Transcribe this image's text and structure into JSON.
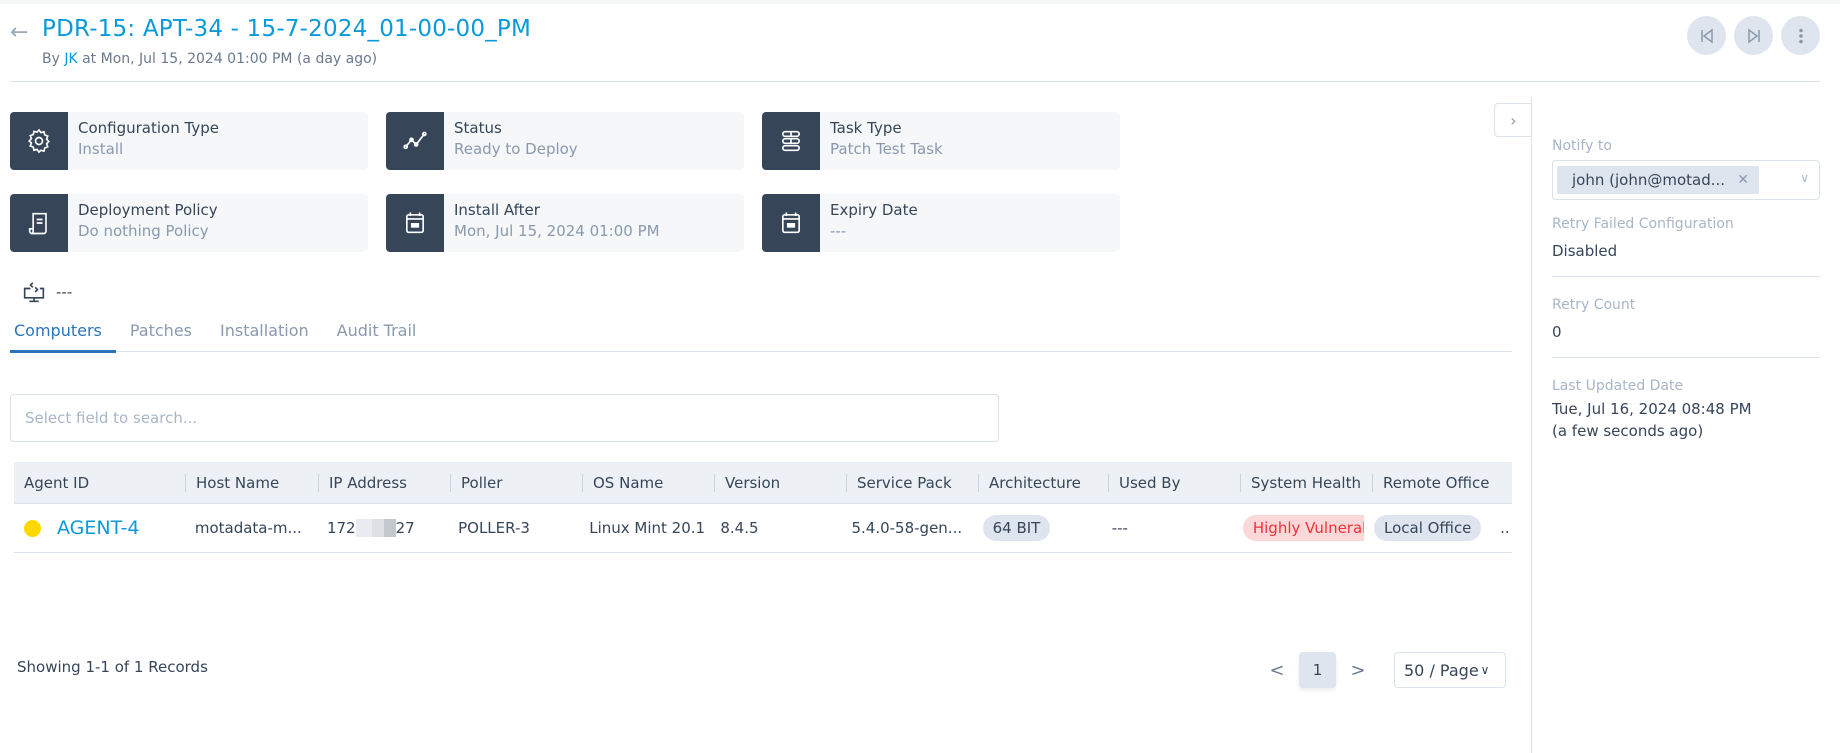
{
  "header": {
    "title": "PDR-15: APT-34 - 15-7-2024_01-00-00_PM",
    "by_prefix": "By ",
    "author": "JK",
    "by_suffix": " at Mon, Jul 15, 2024 01:00 PM (a day ago)"
  },
  "cards": [
    {
      "label": "Configuration Type",
      "value": "Install",
      "icon": "gear-icon"
    },
    {
      "label": "Status",
      "value": "Ready to Deploy",
      "icon": "chart-line-icon"
    },
    {
      "label": "Task Type",
      "value": "Patch Test Task",
      "icon": "task-list-icon"
    },
    {
      "label": "Deployment Policy",
      "value": "Do nothing Policy",
      "icon": "scroll-icon"
    },
    {
      "label": "Install After",
      "value": "Mon, Jul 15, 2024 01:00 PM",
      "icon": "calendar-icon"
    },
    {
      "label": "Expiry Date",
      "value": "---",
      "icon": "calendar-icon"
    }
  ],
  "agent_line": {
    "value": "---",
    "icon": "remote-desktop-icon"
  },
  "tabs": [
    {
      "label": "Computers",
      "active": true
    },
    {
      "label": "Patches"
    },
    {
      "label": "Installation"
    },
    {
      "label": "Audit Trail"
    }
  ],
  "search": {
    "placeholder": "Select field to search...",
    "value": ""
  },
  "table": {
    "columns": [
      "Agent ID",
      "Host Name",
      "IP Address",
      "Poller",
      "OS Name",
      "Version",
      "Service Pack",
      "Architecture",
      "Used By",
      "System Health",
      "Remote Office"
    ],
    "rows": [
      {
        "status_color": "#ffd800",
        "agent_id": "AGENT-4",
        "host_name": "motadata-m...",
        "ip_prefix": "172",
        "ip_suffix": "27",
        "poller": "POLLER-3",
        "os_name": "Linux Mint 20.1",
        "version": "8.4.5",
        "service_pack": "5.4.0-58-gen...",
        "architecture": "64 BIT",
        "used_by": "---",
        "system_health": "Highly Vulnerable",
        "remote_office": "Local Office",
        "overflow": ".."
      }
    ]
  },
  "footer": {
    "records": "Showing 1-1 of 1 Records"
  },
  "pagination": {
    "prev": "<",
    "current": "1",
    "next": ">",
    "page_size": "50 / Page"
  },
  "side": {
    "notify_label": "Notify to",
    "notify_tag": "john (john@motad...",
    "retry_failed_label": "Retry Failed Configuration",
    "retry_failed_value": "Disabled",
    "retry_count_label": "Retry Count",
    "retry_count_value": "0",
    "last_updated_label": "Last Updated Date",
    "last_updated_value": "Tue, Jul 16, 2024 08:48 PM",
    "last_updated_relative": "(a few seconds ago)"
  },
  "colors": {
    "accent": "#0a9ad8",
    "tab_active": "#2b74b9",
    "icon_bg": "#364658",
    "danger": "#f0303a",
    "agent_status": "#ffd800"
  }
}
